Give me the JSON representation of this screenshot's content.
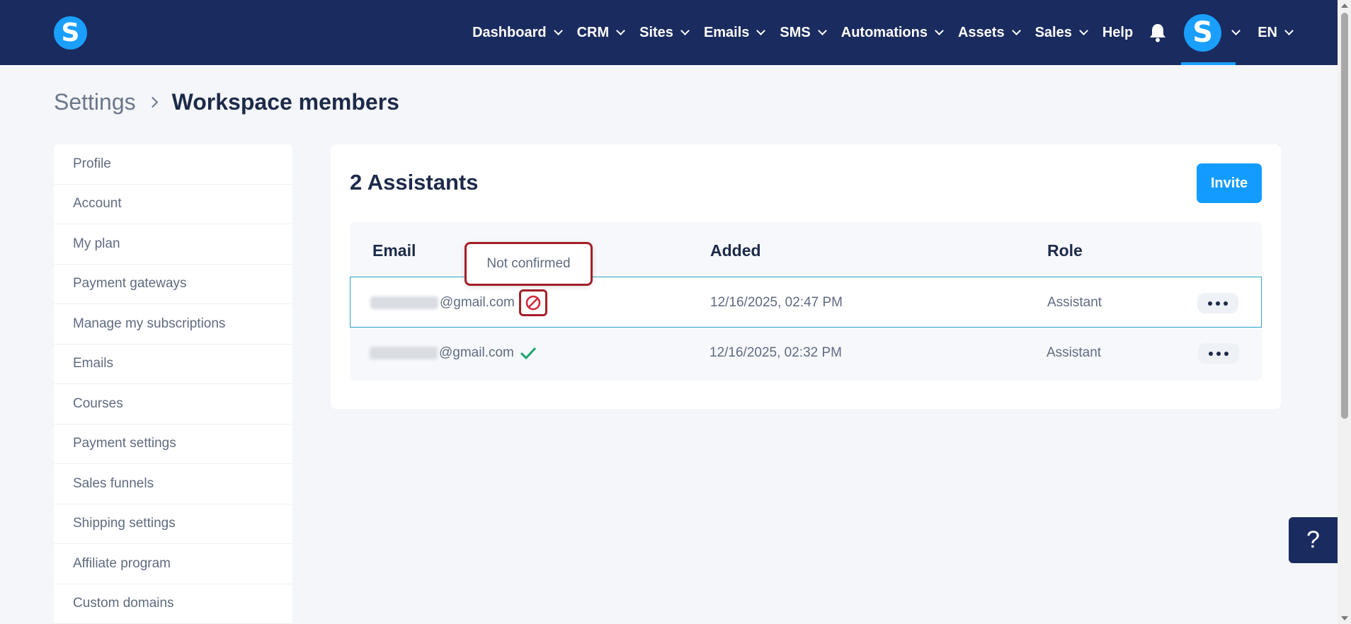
{
  "logo": {
    "letter": "S"
  },
  "nav": {
    "items": [
      {
        "label": "Dashboard",
        "dropdown": true
      },
      {
        "label": "CRM",
        "dropdown": true
      },
      {
        "label": "Sites",
        "dropdown": true
      },
      {
        "label": "Emails",
        "dropdown": true
      },
      {
        "label": "SMS",
        "dropdown": true
      },
      {
        "label": "Automations",
        "dropdown": true
      },
      {
        "label": "Assets",
        "dropdown": true
      },
      {
        "label": "Sales",
        "dropdown": true
      },
      {
        "label": "Help",
        "dropdown": false
      }
    ],
    "avatar_letter": "S",
    "language": "EN"
  },
  "breadcrumb": {
    "root": "Settings",
    "current": "Workspace members"
  },
  "sidebar": {
    "items": [
      "Profile",
      "Account",
      "My plan",
      "Payment gateways",
      "Manage my subscriptions",
      "Emails",
      "Courses",
      "Payment settings",
      "Sales funnels",
      "Shipping settings",
      "Affiliate program",
      "Custom domains"
    ]
  },
  "card": {
    "title": "2 Assistants",
    "invite_label": "Invite",
    "columns": {
      "email": "Email",
      "added": "Added",
      "role": "Role"
    },
    "rows": [
      {
        "email_domain": "@gmail.com",
        "status": "not-confirmed",
        "added": "12/16/2025, 02:47 PM",
        "role": "Assistant"
      },
      {
        "email_domain": "@gmail.com",
        "status": "confirmed",
        "added": "12/16/2025, 02:32 PM",
        "role": "Assistant"
      }
    ],
    "tooltip": "Not confirmed"
  },
  "help_widget": {
    "label": "?"
  },
  "colors": {
    "nav_bg": "#1a2b5f",
    "accent": "#139cff",
    "highlight": "#a32028",
    "confirm": "#1aa46b"
  }
}
